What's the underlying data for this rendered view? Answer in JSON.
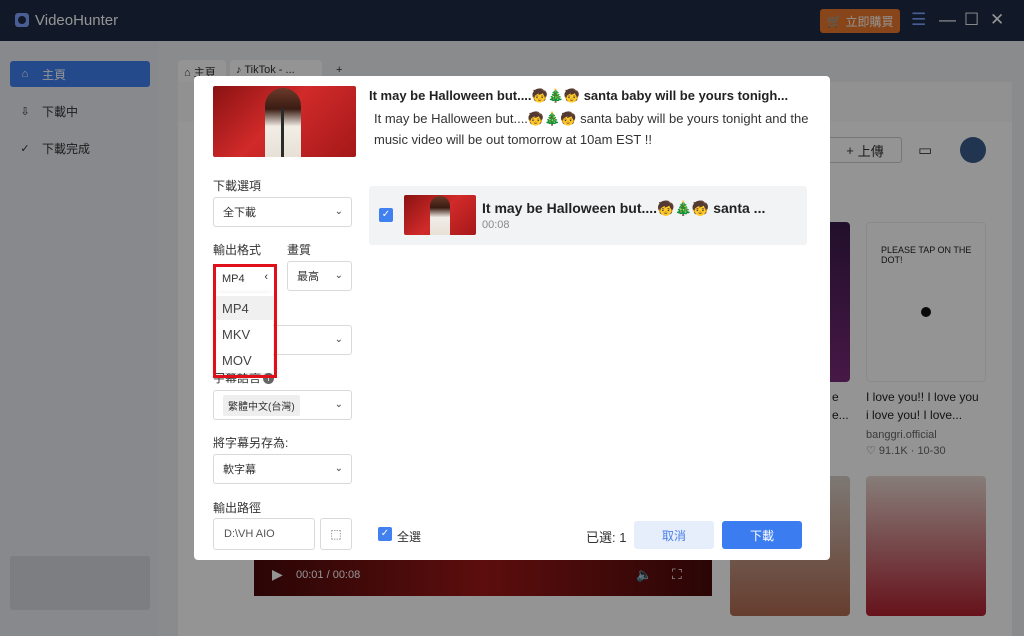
{
  "app": {
    "title": "VideoHunter",
    "buy_label": "立即購買"
  },
  "window_controls": {
    "menu": "☰",
    "minimize": "—",
    "maximize": "☐",
    "close": "✕"
  },
  "sidebar": {
    "items": [
      {
        "label": "主頁",
        "icon": "home-icon"
      },
      {
        "label": "下載中",
        "icon": "download-icon"
      },
      {
        "label": "下載完成",
        "icon": "check-circle-icon"
      }
    ]
  },
  "browser": {
    "tabs": [
      {
        "label": "主頁"
      },
      {
        "label": "TikTok - ..."
      }
    ],
    "new_tab": "+",
    "upload_label": "上傳",
    "player_time": "00:01 / 00:08",
    "cards": [
      {
        "line1": "e",
        "line2": "e..."
      },
      {
        "line1": "I love you!! I love you",
        "line2": "i love you! I love...",
        "author": "banggri.official",
        "stats": "♡ 91.1K · 10-30"
      }
    ],
    "card_doodle_text": "PLEASE TAP ON THE DOT!"
  },
  "dialog": {
    "video_title": "It may be Halloween but....🧒🎄🧒 santa baby will be yours tonigh...",
    "video_desc": "It may be Halloween but....🧒🎄🧒 santa baby will be yours tonight and the music video will be out tomorrow at 10am EST !!",
    "download_options_label": "下載選項",
    "download_options_value": "全下載",
    "output_format_label": "輸出格式",
    "output_format_value": "MP4",
    "format_options": [
      "MP4",
      "MKV",
      "MOV"
    ],
    "quality_label": "畫質",
    "quality_value": "最高",
    "subtitle_lang_label": "字幕語言",
    "subtitle_lang_value": "繁體中文(台灣)",
    "save_subtitle_label": "將字幕另存為:",
    "save_subtitle_value": "軟字幕",
    "output_path_label": "輸出路徑",
    "output_path_value": "D:\\VH AIO",
    "list": [
      {
        "title": "It may be Halloween but....🧒🎄🧒 santa ...",
        "duration": "00:08"
      }
    ],
    "select_all_label": "全選",
    "selected_count": "已選: 1",
    "cancel_label": "取消",
    "download_label": "下載"
  },
  "colors": {
    "accent": "#3b7cf0",
    "titlebar": "#1e2a44",
    "buy": "#e8782c",
    "highlight": "#e0101a"
  }
}
